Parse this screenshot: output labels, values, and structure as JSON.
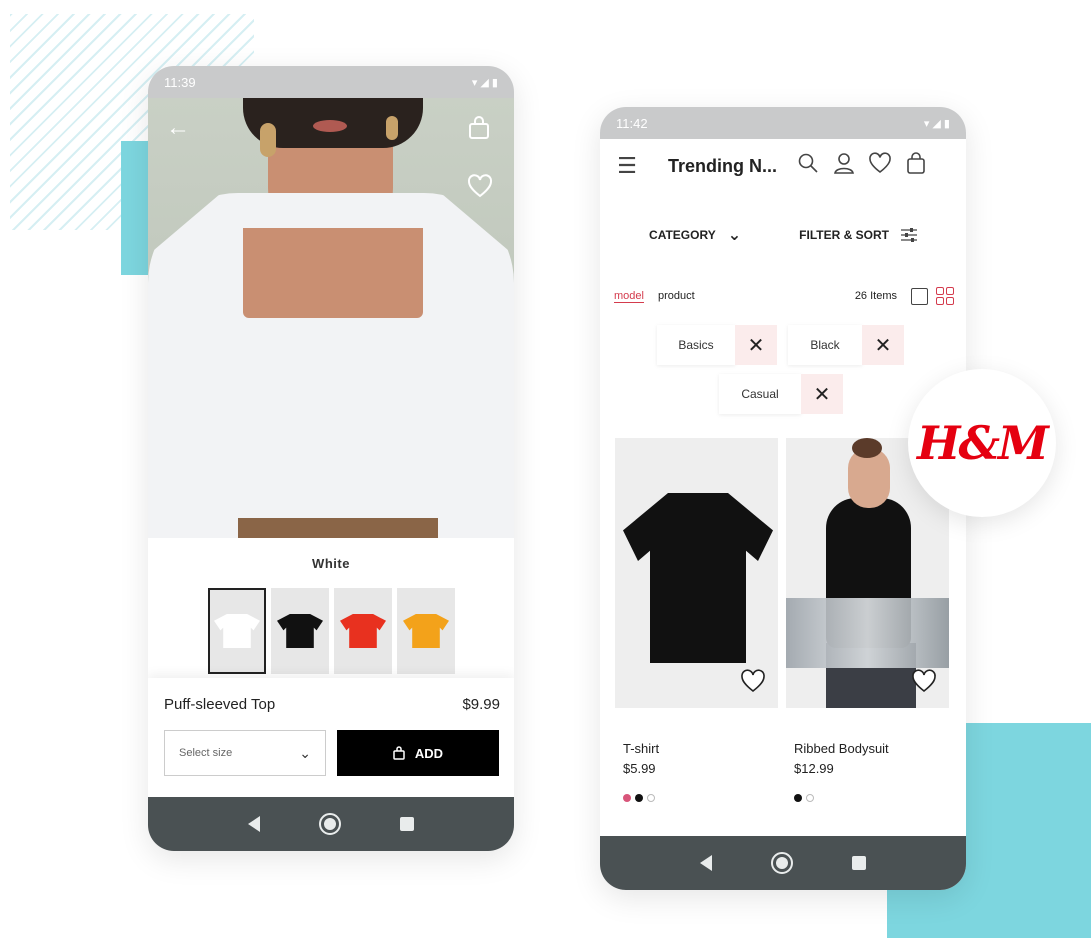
{
  "colors": {
    "accent_teal": "#7dd6df",
    "brand_red": "#e50010",
    "highlight_red": "#d43b4d",
    "nav_dark": "#4a5153"
  },
  "brand": {
    "logo_text": "H&M"
  },
  "detail_screen": {
    "status_time": "11:39",
    "icons": [
      "back-arrow-icon",
      "bag-icon",
      "heart-icon"
    ],
    "selected_color": "White",
    "swatches": [
      {
        "name": "white",
        "color": "#ffffff"
      },
      {
        "name": "black",
        "color": "#111111"
      },
      {
        "name": "red",
        "color": "#e8311f"
      },
      {
        "name": "orange",
        "color": "#f3a21a"
      }
    ],
    "product_name": "Puff-sleeved Top",
    "price": "$9.99",
    "size_placeholder": "Select size",
    "add_label": "ADD"
  },
  "listing_screen": {
    "status_time": "11:42",
    "title": "Trending N...",
    "category_label": "CATEGORY",
    "filter_label": "FILTER & SORT",
    "tab_model": "model",
    "tab_product": "product",
    "item_count": "26 Items",
    "chips": [
      "Basics",
      "Black",
      "Casual"
    ],
    "products": [
      {
        "name": "T-shirt",
        "price": "$5.99",
        "dot_colors": [
          "#d8557a",
          "#111111",
          "#ffffff"
        ]
      },
      {
        "name": "Ribbed Bodysuit",
        "price": "$12.99",
        "dot_colors": [
          "#111111",
          "#ffffff"
        ]
      }
    ]
  }
}
